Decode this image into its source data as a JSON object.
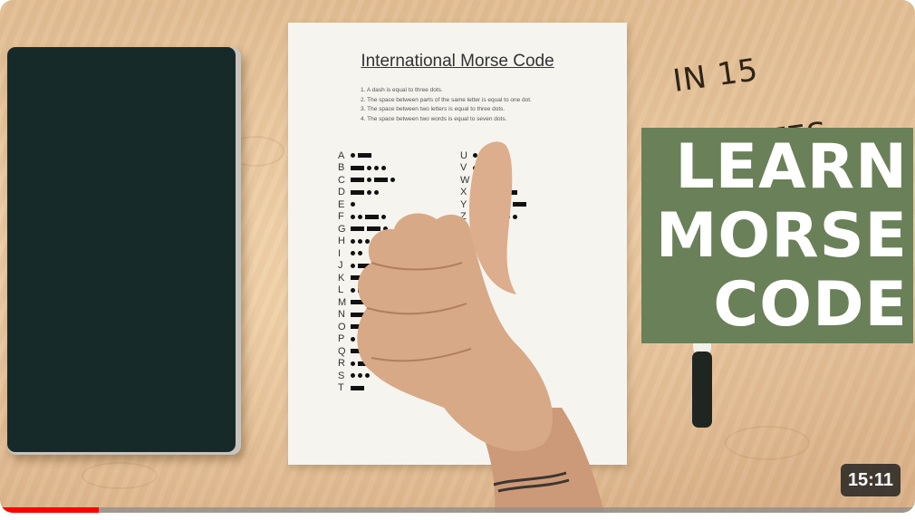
{
  "video": {
    "duration": "15:11",
    "watched_fraction": 0.108,
    "progress_color": "#ff0000"
  },
  "thumbnail": {
    "tagline": "IN 15 MINUTES",
    "banner_lines": [
      "LEARN",
      "MORSE",
      "CODE"
    ],
    "banner_color": "#6a8058"
  },
  "sheet": {
    "title": "International Morse Code",
    "rules": [
      "1. A dash is equal to three dots.",
      "2. The space between parts of the same letter is equal to one dot.",
      "3. The space between two letters is equal to three dots.",
      "4. The space between two words is equal to seven dots."
    ],
    "left_column": [
      {
        "letter": "A",
        "code": ".-"
      },
      {
        "letter": "B",
        "code": "-..."
      },
      {
        "letter": "C",
        "code": "-.-."
      },
      {
        "letter": "D",
        "code": "-.."
      },
      {
        "letter": "E",
        "code": "."
      },
      {
        "letter": "F",
        "code": "..-."
      },
      {
        "letter": "G",
        "code": "--."
      },
      {
        "letter": "H",
        "code": "...."
      },
      {
        "letter": "I",
        "code": ".."
      },
      {
        "letter": "J",
        "code": ".---"
      },
      {
        "letter": "K",
        "code": "-.-"
      },
      {
        "letter": "L",
        "code": ".-.."
      },
      {
        "letter": "M",
        "code": "--"
      },
      {
        "letter": "N",
        "code": "-."
      },
      {
        "letter": "O",
        "code": "---"
      },
      {
        "letter": "P",
        "code": ".--."
      },
      {
        "letter": "Q",
        "code": "--.-"
      },
      {
        "letter": "R",
        "code": ".-."
      },
      {
        "letter": "S",
        "code": "..."
      },
      {
        "letter": "T",
        "code": "-"
      }
    ],
    "right_column": [
      {
        "letter": "U",
        "code": "..-"
      },
      {
        "letter": "V",
        "code": "...-"
      },
      {
        "letter": "W",
        "code": ".--"
      },
      {
        "letter": "X",
        "code": "-..-"
      },
      {
        "letter": "Y",
        "code": "-.--"
      },
      {
        "letter": "Z",
        "code": "--.."
      }
    ]
  },
  "icons": {
    "hand": "thumbs-up-icon"
  }
}
